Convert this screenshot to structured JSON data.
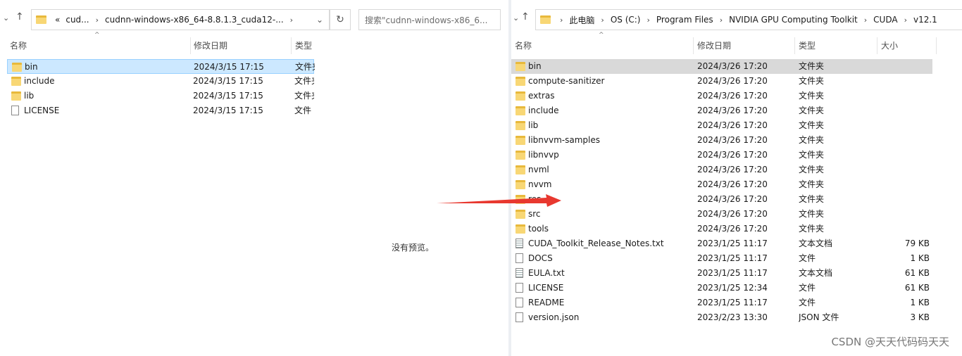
{
  "left": {
    "address_segments": [
      "«",
      "cud...",
      "cudnn-windows-x86_64-8.8.1.3_cuda12-..."
    ],
    "search_placeholder": "搜索\"cudnn-windows-x86_6...",
    "columns": [
      "名称",
      "修改日期",
      "类型"
    ],
    "files": [
      {
        "name": "bin",
        "date": "2024/3/15 17:15",
        "type": "文件夹",
        "icon": "folder"
      },
      {
        "name": "include",
        "date": "2024/3/15 17:15",
        "type": "文件夹",
        "icon": "folder"
      },
      {
        "name": "lib",
        "date": "2024/3/15 17:15",
        "type": "文件夹",
        "icon": "folder"
      },
      {
        "name": "LICENSE",
        "date": "2024/3/15 17:15",
        "type": "文件",
        "icon": "file"
      }
    ],
    "preview_text": "没有预览。"
  },
  "right": {
    "address_segments": [
      "此电脑",
      "OS (C:)",
      "Program Files",
      "NVIDIA GPU Computing Toolkit",
      "CUDA",
      "v12.1"
    ],
    "columns": [
      "名称",
      "修改日期",
      "类型",
      "大小"
    ],
    "files": [
      {
        "name": "bin",
        "date": "2024/3/26 17:20",
        "type": "文件夹",
        "size": "",
        "icon": "folder"
      },
      {
        "name": "compute-sanitizer",
        "date": "2024/3/26 17:20",
        "type": "文件夹",
        "size": "",
        "icon": "folder"
      },
      {
        "name": "extras",
        "date": "2024/3/26 17:20",
        "type": "文件夹",
        "size": "",
        "icon": "folder"
      },
      {
        "name": "include",
        "date": "2024/3/26 17:20",
        "type": "文件夹",
        "size": "",
        "icon": "folder"
      },
      {
        "name": "lib",
        "date": "2024/3/26 17:20",
        "type": "文件夹",
        "size": "",
        "icon": "folder"
      },
      {
        "name": "libnvvm-samples",
        "date": "2024/3/26 17:20",
        "type": "文件夹",
        "size": "",
        "icon": "folder"
      },
      {
        "name": "libnvvp",
        "date": "2024/3/26 17:20",
        "type": "文件夹",
        "size": "",
        "icon": "folder"
      },
      {
        "name": "nvml",
        "date": "2024/3/26 17:20",
        "type": "文件夹",
        "size": "",
        "icon": "folder"
      },
      {
        "name": "nvvm",
        "date": "2024/3/26 17:20",
        "type": "文件夹",
        "size": "",
        "icon": "folder"
      },
      {
        "name": "res",
        "date": "2024/3/26 17:20",
        "type": "文件夹",
        "size": "",
        "icon": "folder"
      },
      {
        "name": "src",
        "date": "2024/3/26 17:20",
        "type": "文件夹",
        "size": "",
        "icon": "folder"
      },
      {
        "name": "tools",
        "date": "2024/3/26 17:20",
        "type": "文件夹",
        "size": "",
        "icon": "folder"
      },
      {
        "name": "CUDA_Toolkit_Release_Notes.txt",
        "date": "2023/1/25 11:17",
        "type": "文本文档",
        "size": "79 KB",
        "icon": "text"
      },
      {
        "name": "DOCS",
        "date": "2023/1/25 11:17",
        "type": "文件",
        "size": "1 KB",
        "icon": "file"
      },
      {
        "name": "EULA.txt",
        "date": "2023/1/25 11:17",
        "type": "文本文档",
        "size": "61 KB",
        "icon": "text"
      },
      {
        "name": "LICENSE",
        "date": "2023/1/25 12:34",
        "type": "文件",
        "size": "61 KB",
        "icon": "file"
      },
      {
        "name": "README",
        "date": "2023/1/25 11:17",
        "type": "文件",
        "size": "1 KB",
        "icon": "file"
      },
      {
        "name": "version.json",
        "date": "2023/2/23 13:30",
        "type": "JSON 文件",
        "size": "3 KB",
        "icon": "file"
      }
    ]
  },
  "watermark": "CSDN @天天代码码天天",
  "colors": {
    "selected_bg": "#cce8ff",
    "hover_bg": "#d9d9d9",
    "folder": "#f8d775",
    "arrow": "#e8382f"
  }
}
